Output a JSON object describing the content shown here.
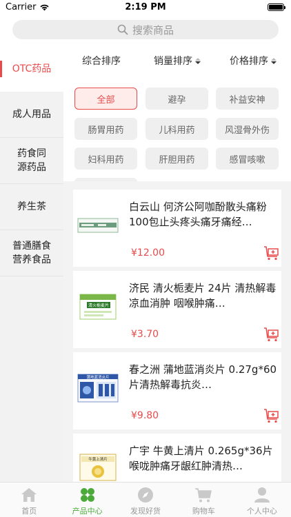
{
  "status": {
    "carrier": "Carrier",
    "time": "2:19 PM"
  },
  "search": {
    "placeholder": "搜索商品"
  },
  "sidebar": {
    "items": [
      {
        "label": "OTC药品",
        "active": true
      },
      {
        "label": "成人用品"
      },
      {
        "label": "药食同源药品"
      },
      {
        "label": "养生茶"
      },
      {
        "label": "普通膳食营养食品"
      }
    ]
  },
  "sort": {
    "items": [
      {
        "label": "综合排序"
      },
      {
        "label": "销量排序"
      },
      {
        "label": "价格排序"
      }
    ]
  },
  "filters": {
    "tags": [
      "全部",
      "避孕",
      "补益安神",
      "肠胃用药",
      "儿科用药",
      "风湿骨外伤",
      "妇科用药",
      "肝胆用药",
      "感冒咳嗽"
    ]
  },
  "products": [
    {
      "title": "白云山 何济公阿咖酚散头痛粉100包止头疼头痛牙痛经…",
      "price": "¥12.00",
      "img_label": ""
    },
    {
      "title": "济民 清火栀麦片 24片 清热解毒 凉血消肿 咽喉肿痛…",
      "price": "¥3.70",
      "img_label": "清火栀麦片"
    },
    {
      "title": "春之洲 蒲地蓝消炎片 0.27g*60片清热解毒抗炎…",
      "price": "¥9.80",
      "img_label": "蒲地蓝消炎片"
    },
    {
      "title": "广宇 牛黄上清片 0.265g*36片喉咙肿痛牙龈红肿清热…",
      "price": "",
      "img_label": "牛黄上清片"
    }
  ],
  "tabbar": {
    "items": [
      {
        "label": "首页",
        "icon": "home-icon"
      },
      {
        "label": "产品中心",
        "icon": "grid-icon",
        "active": true
      },
      {
        "label": "发现好货",
        "icon": "compass-icon"
      },
      {
        "label": "购物车",
        "icon": "cart-icon"
      },
      {
        "label": "个人中心",
        "icon": "user-icon"
      }
    ]
  },
  "colors": {
    "accent": "#e84a4a",
    "tab_active": "#4caa3b"
  }
}
